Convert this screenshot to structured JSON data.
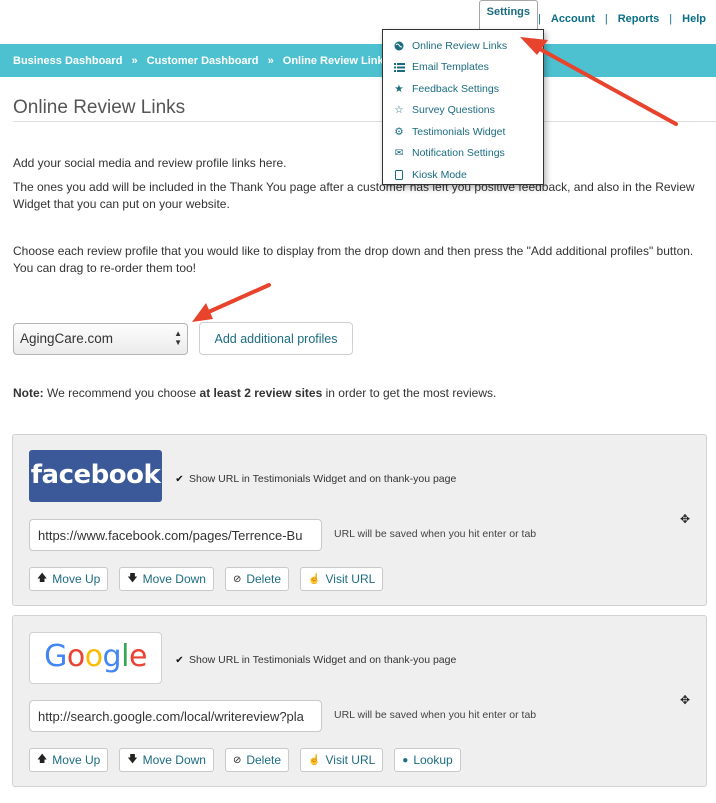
{
  "topnav": {
    "settings": "Settings",
    "account": "Account",
    "reports": "Reports",
    "help": "Help",
    "separator": "|"
  },
  "breadcrumb": {
    "items": [
      "Business Dashboard",
      "Customer Dashboard",
      "Online Review Links"
    ],
    "separator": "»"
  },
  "settings_menu": {
    "items": [
      {
        "label": "Online Review Links",
        "icon": "globe-icon"
      },
      {
        "label": "Email Templates",
        "icon": "list-icon"
      },
      {
        "label": "Feedback Settings",
        "icon": "star-filled-icon"
      },
      {
        "label": "Survey Questions",
        "icon": "star-outline-icon"
      },
      {
        "label": "Testimonials Widget",
        "icon": "gear-icon"
      },
      {
        "label": "Notification Settings",
        "icon": "envelope-icon"
      },
      {
        "label": "Kiosk Mode",
        "icon": "tablet-icon"
      }
    ]
  },
  "page": {
    "title": "Online Review Links",
    "intro1": "Add your social media and review profile links here.",
    "intro2": "The ones you add will be included in the Thank You page after a customer has left you positive feedback, and also in the Review Widget that you can put on your website.",
    "intro3": "Choose each review profile that you would like to display from the drop down and then press the \"Add additional profiles\" button. You can drag to re-order them too!",
    "select_value": "AgingCare.com",
    "add_button": "Add additional profiles",
    "note_label": "Note:",
    "note_pre": " We recommend you choose ",
    "note_bold": "at least 2 review sites",
    "note_post": " in order to get the most reviews."
  },
  "profiles": [
    {
      "logo_text": "facebook",
      "show_label": "Show URL in Testimonials Widget and on thank-you page",
      "url": "https://www.facebook.com/pages/Terrence-Bu",
      "hint": "URL will be saved when you hit enter or tab",
      "buttons": [
        "Move Up",
        "Move Down",
        "Delete",
        "Visit URL"
      ]
    },
    {
      "logo_text": "Google",
      "show_label": "Show URL in Testimonials Widget and on thank-you page",
      "url": "http://search.google.com/local/writereview?pla",
      "hint": "URL will be saved when you hit enter or tab",
      "buttons": [
        "Move Up",
        "Move Down",
        "Delete",
        "Visit URL",
        "Lookup"
      ]
    }
  ],
  "colors": {
    "accent": "#4ec1d1",
    "link": "#1c6c82",
    "facebook": "#3b5998",
    "annotation_arrow": "#e8442d"
  }
}
